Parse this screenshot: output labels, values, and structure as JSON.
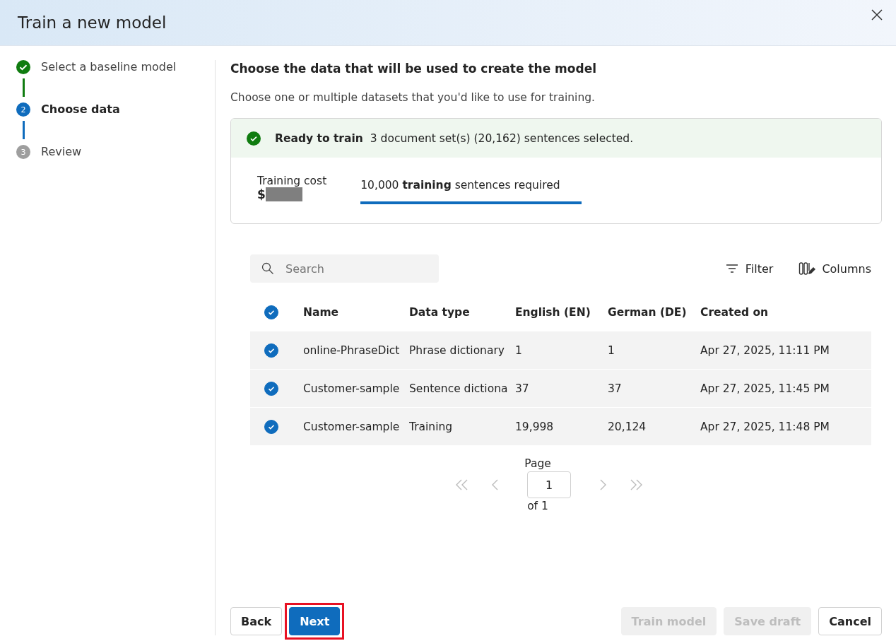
{
  "dialog": {
    "title": "Train a new model"
  },
  "steps": [
    {
      "label": "Select a baseline model",
      "completed": true,
      "selected": false
    },
    {
      "number": "2",
      "label": "Choose data",
      "completed": false,
      "selected": true
    },
    {
      "number": "3",
      "label": "Review",
      "completed": false,
      "selected": false
    }
  ],
  "heading": "Choose the data that will be used to create the model",
  "description": "Choose one or multiple datasets that you'd like to use for training.",
  "summary": {
    "status_title": "Ready to train",
    "status_text": "3 document set(s) (20,162) sentences selected.",
    "cost_label": "Training cost",
    "cost_currency": "$",
    "cost_redacted": true,
    "requirement": "10,000 **training** sentences required",
    "level": 1
  },
  "toolbar": {
    "search": {
      "placeholder": "Search"
    },
    "buttons": [
      {
        "kind": "filter",
        "label": "Filter"
      },
      {
        "kind": "columns",
        "label": "Columns"
      }
    ]
  },
  "table": {
    "all_checked": true,
    "columns": [
      "Name",
      "Data type",
      "English (EN)",
      "German (DE)",
      "Created on"
    ],
    "rows": [
      {
        "checked": true,
        "cells": [
          "online-PhraseDict",
          "Phrase dictionary",
          "1",
          "1",
          "Apr 27, 2025, 11:11 PM"
        ]
      },
      {
        "checked": true,
        "cells": [
          "Customer-sample",
          "Sentence dictiona",
          "37",
          "37",
          "Apr 27, 2025, 11:45 PM"
        ]
      },
      {
        "checked": true,
        "cells": [
          "Customer-sample",
          "Training",
          "19,998",
          "20,124",
          "Apr 27, 2025, 11:48 PM"
        ]
      }
    ]
  },
  "pagination": {
    "page_label": "Page",
    "page": "1",
    "of_label": "of 1"
  },
  "footer": {
    "left": [
      {
        "label": "Back",
        "kind": "default",
        "disabled": false,
        "highlighted": false
      },
      {
        "label": "Next",
        "kind": "primary",
        "disabled": false,
        "highlighted": true
      }
    ],
    "right": [
      {
        "label": "Train model",
        "disabled": true
      },
      {
        "label": "Save draft",
        "disabled": true
      },
      {
        "label": "Cancel",
        "disabled": false
      }
    ]
  }
}
